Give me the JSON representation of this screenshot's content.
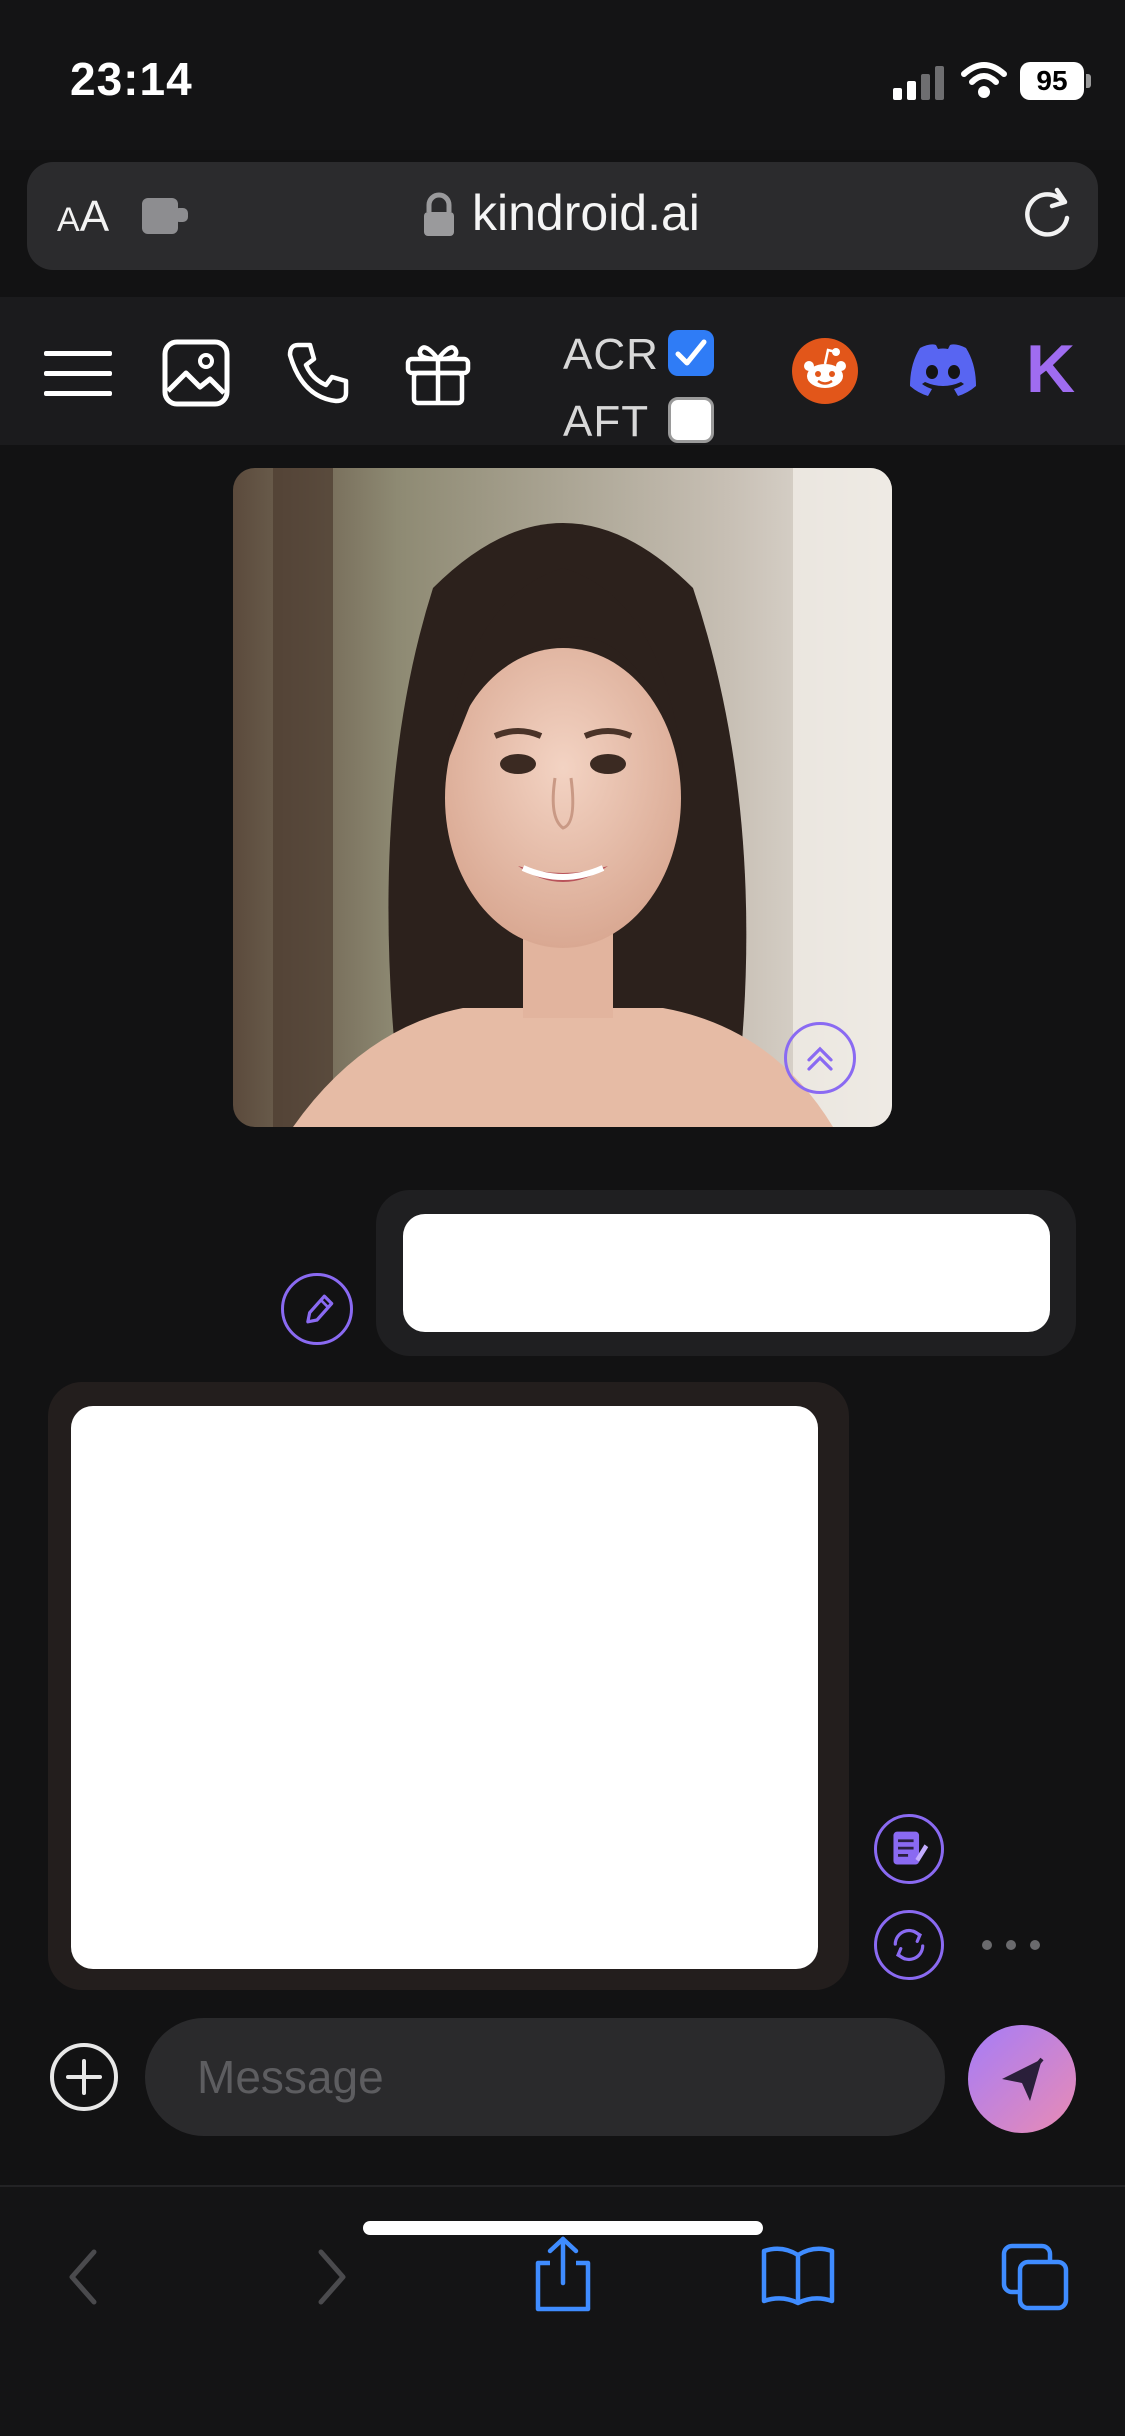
{
  "status_bar": {
    "time": "23:14",
    "battery": "95"
  },
  "address_bar": {
    "aa_small": "A",
    "aa_large": "A",
    "url": "kindroid.ai"
  },
  "toolbar": {
    "acr_label": "ACR",
    "acr_checked": true,
    "aft_label": "AFT",
    "aft_checked": false,
    "k_logo": "K"
  },
  "composer": {
    "placeholder": "Message"
  },
  "colors": {
    "accent": "#8a6af2",
    "checkbox_blue": "#2f7cf6",
    "reddit": "#e2561a",
    "discord": "#5865f2",
    "k_logo": "#9f6cf0"
  }
}
